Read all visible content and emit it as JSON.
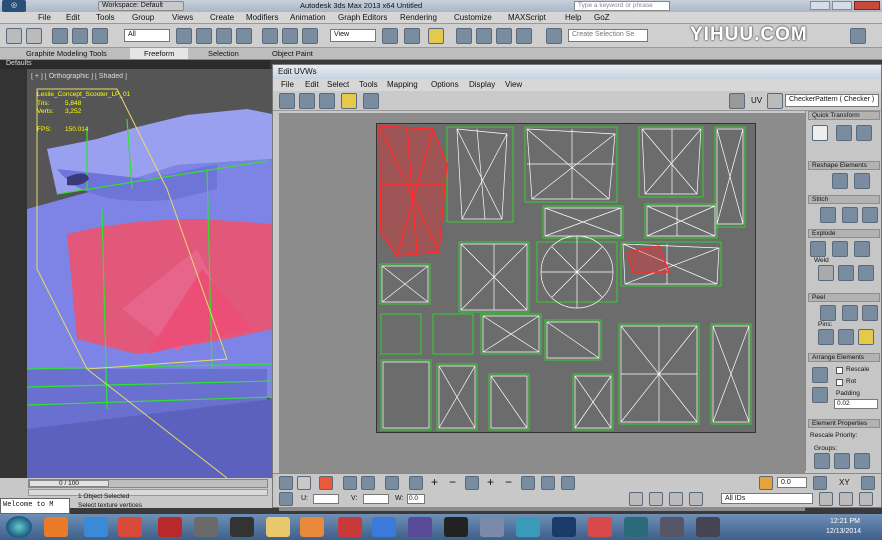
{
  "titlebar": {
    "workspace": "Workspace: Default",
    "title": "Autodesk 3ds Max  2013 x64     Untitled",
    "search_placeholder": "Type a keyword or phrase",
    "watermark": "YIHUU.COM"
  },
  "menubar": {
    "items": [
      "File",
      "Edit",
      "Tools",
      "Group",
      "Views",
      "Create",
      "Modifiers",
      "Animation",
      "Graph Editors",
      "Rendering",
      "Customize",
      "MAXScript",
      "Help",
      "GoZ"
    ]
  },
  "toolbar": {
    "filter_value": "All",
    "view_value": "View",
    "selection_set_placeholder": "Create Selection Se"
  },
  "ribbon": {
    "tabs": [
      "Graphite Modeling Tools",
      "Freeform",
      "Selection",
      "Object Paint"
    ]
  },
  "defaults_label": "Defaults",
  "viewport": {
    "label": "[ + ] [ Orthographic ] [ Shaded ]",
    "object_name": "Leslie_Concept_Scooter_LP_01",
    "stats": [
      {
        "label": "Tris:",
        "value": "5,848"
      },
      {
        "label": "Verts:",
        "value": "3,252"
      }
    ],
    "fps_label": "FPS:",
    "fps_value": "150.014"
  },
  "timeline": {
    "frame": "0 / 100"
  },
  "status": {
    "selected": "1 Object Selected",
    "hint": "Select texture vertices",
    "welcome": "Welcome to M"
  },
  "uvw": {
    "title": "Edit UVWs",
    "menu": [
      "File",
      "Edit",
      "Select",
      "Tools",
      "Mapping",
      "Options",
      "Display",
      "View"
    ],
    "uv_label": "UV",
    "texture_value": "CheckerPattern  ( Checker )",
    "bottom": {
      "u_label": "U:",
      "v_label": "V:",
      "w_label": "W:",
      "w_value": "0.0",
      "spin_value": "0.0",
      "ids_value": "All IDs",
      "zoom_value": "0.0",
      "xy_label": "XY"
    }
  },
  "right_panel": {
    "sections": [
      {
        "title": "Quick Transform"
      },
      {
        "title": "Reshape Elements"
      },
      {
        "title": "Stitch"
      },
      {
        "title": "Explode"
      },
      {
        "title": "Peel"
      },
      {
        "title": "Arrange Elements"
      },
      {
        "title": "Element Properties"
      }
    ],
    "weld_label": "Weld",
    "pins_label": "Pins:",
    "rescale_label": "Rescale",
    "rotate_label": "Rot",
    "padding_label": "Padding",
    "padding_value": "0.02",
    "rescale_priority_label": "Rescale Priority:",
    "groups_label": "Groups:"
  },
  "taskbar": {
    "time": "12:21 PM",
    "date": "12/13/2014"
  },
  "colors": {
    "uv_shell_stroke": "#ffffff",
    "uv_shell_border": "#2fd02f",
    "uv_selected": "#ff2a2a",
    "model_blue": "#7e84e6",
    "model_pink": "#e1587a"
  }
}
